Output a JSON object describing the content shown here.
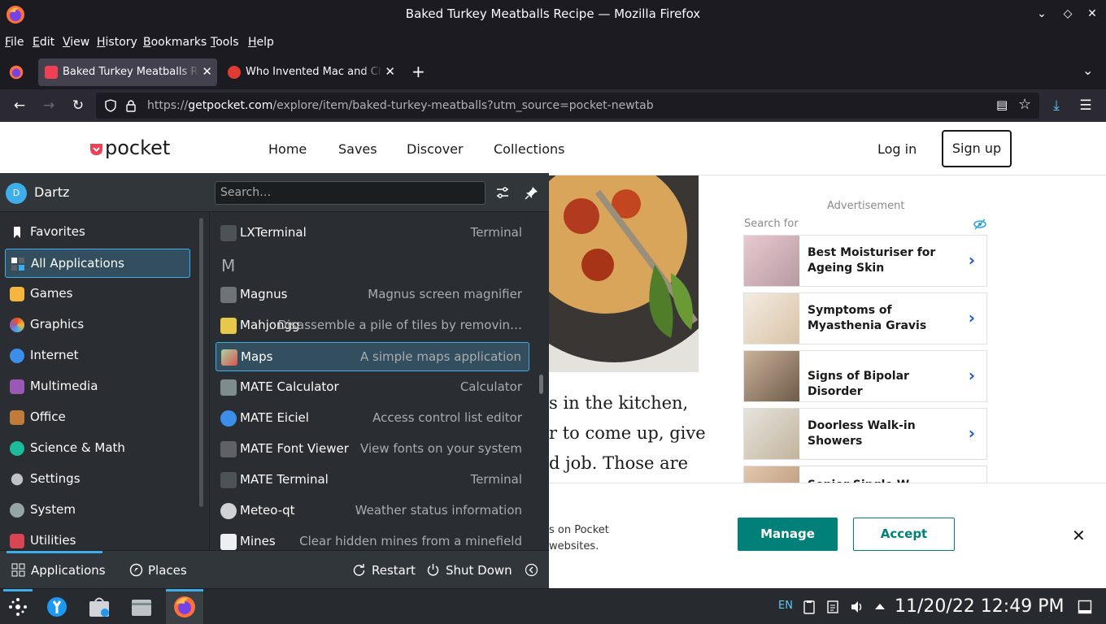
{
  "window": {
    "title": "Baked Turkey Meatballs Recipe — Mozilla Firefox"
  },
  "menubar": [
    "File",
    "Edit",
    "View",
    "History",
    "Bookmarks",
    "Tools",
    "Help"
  ],
  "tabs": [
    {
      "label": "Baked Turkey Meatballs Recipe | Pocket",
      "active": true
    },
    {
      "label": "Who Invented Mac and Cheese?",
      "active": false
    }
  ],
  "urlbar": {
    "prefix": "https://",
    "domain": "getpocket.com",
    "path": "/explore/item/baked-turkey-meatballs?utm_source=pocket-newtab"
  },
  "pocket": {
    "logo": "pocket",
    "nav": [
      "Home",
      "Saves",
      "Discover",
      "Collections"
    ],
    "active_nav": "Discover",
    "login": "Log in",
    "signup": "Sign up"
  },
  "article": {
    "lines": [
      "s in the kitchen,",
      "r to come up, give",
      "d job. Those are"
    ]
  },
  "ads": {
    "label": "Advertisement",
    "search_for": "Search for",
    "items": [
      {
        "text": "Best Moisturiser for Ageing Skin"
      },
      {
        "text": "Symptoms of Myasthenia Gravis"
      },
      {
        "text": "Signs of Bipolar Disorder"
      },
      {
        "text": "Doorless Walk-in Showers"
      },
      {
        "text": "Senior Single W..."
      }
    ]
  },
  "cookie": {
    "line1": "s on Pocket",
    "line2": "websites.",
    "manage": "Manage",
    "accept": "Accept"
  },
  "launcher": {
    "user": "Dartz",
    "avatar_letter": "D",
    "search_placeholder": "Search…",
    "categories": [
      {
        "label": "Favorites",
        "icon": "bookmark-icon",
        "color": "#fcfcfc"
      },
      {
        "label": "All Applications",
        "icon": "grid-icon",
        "color": "#3daee9"
      },
      {
        "label": "Games",
        "icon": "gamepad-icon",
        "color": "#f4b63f"
      },
      {
        "label": "Graphics",
        "icon": "palette-icon",
        "color": "#e95420"
      },
      {
        "label": "Internet",
        "icon": "globe-icon",
        "color": "#3d8ee9"
      },
      {
        "label": "Multimedia",
        "icon": "media-icon",
        "color": "#9b59b6"
      },
      {
        "label": "Office",
        "icon": "briefcase-icon",
        "color": "#c07a3a"
      },
      {
        "label": "Science & Math",
        "icon": "atom-icon",
        "color": "#1abc9c"
      },
      {
        "label": "Settings",
        "icon": "settings-icon",
        "color": "#bdc3c7"
      },
      {
        "label": "System",
        "icon": "system-icon",
        "color": "#95a5a6"
      },
      {
        "label": "Utilities",
        "icon": "toolbox-icon",
        "color": "#da4453"
      }
    ],
    "section_letter": "M",
    "apps": [
      {
        "name": "LXTerminal",
        "desc": "Terminal",
        "icon_color": "#4d5257"
      },
      {
        "name": "Magnus",
        "desc": "Magnus screen magnifier",
        "icon_color": "#6e7378"
      },
      {
        "name": "Mahjongg",
        "desc": "Disassemble a pile of tiles by removin…",
        "icon_color": "#e8c84a"
      },
      {
        "name": "Maps",
        "desc": "A simple maps application",
        "icon_color": "#d9534f"
      },
      {
        "name": "MATE Calculator",
        "desc": "Calculator",
        "icon_color": "#7f8c8d"
      },
      {
        "name": "MATE Eiciel",
        "desc": "Access control list editor",
        "icon_color": "#3d8ee9"
      },
      {
        "name": "MATE Font Viewer",
        "desc": "View fonts on your system",
        "icon_color": "#5e6266"
      },
      {
        "name": "MATE Terminal",
        "desc": "Terminal",
        "icon_color": "#4d5257"
      },
      {
        "name": "Meteo-qt",
        "desc": "Weather status information",
        "icon_color": "#cfd3d6"
      },
      {
        "name": "Mines",
        "desc": "Clear hidden mines from a minefield",
        "icon_color": "#ecf0f1"
      }
    ],
    "footer": {
      "applications": "Applications",
      "places": "Places",
      "restart": "Restart",
      "shutdown": "Shut Down"
    }
  },
  "taskbar": {
    "lang": "EN",
    "clock": "11/20/22 12:49 PM"
  }
}
